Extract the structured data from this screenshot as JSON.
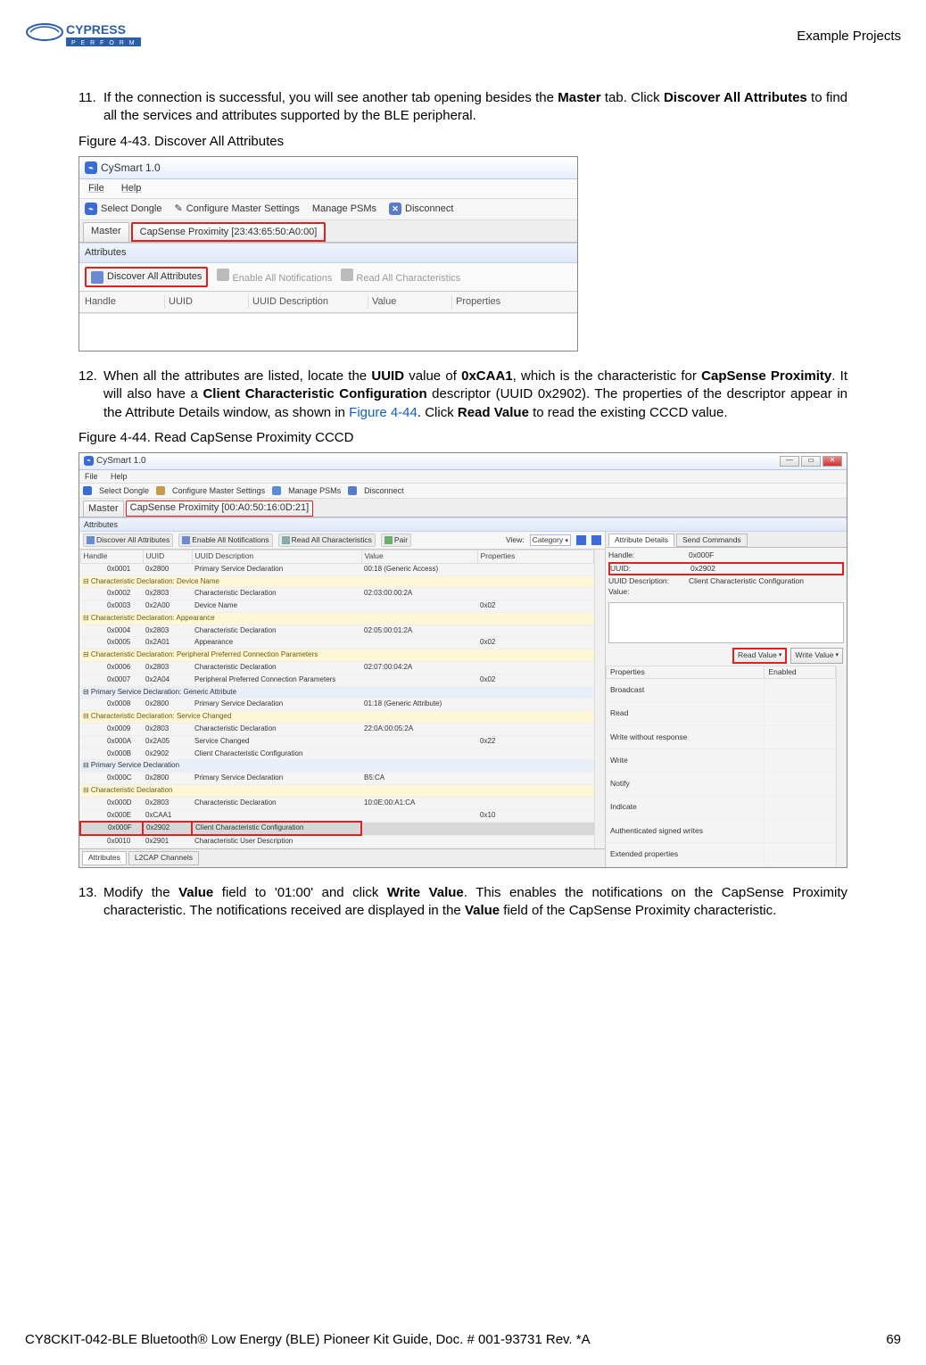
{
  "header": {
    "section": "Example Projects"
  },
  "logo": {
    "brand_top": "CYPRESS",
    "brand_sub": "P E R F O R M"
  },
  "step11": {
    "num": "11.",
    "text_a": "If the connection is successful, you will see another tab opening besides the ",
    "b1": "Master",
    "text_b": " tab. Click ",
    "b2": "Discover All Attributes",
    "text_c": " to find all the services and attributes supported by the BLE peripheral."
  },
  "fig43": {
    "caption": "Figure 4-43.  Discover All Attributes",
    "title": "CySmart 1.0",
    "menu_file": "File",
    "menu_help": "Help",
    "tb_select": "Select Dongle",
    "tb_conf": "Configure Master Settings",
    "tb_psm": "Manage PSMs",
    "tb_disc": "Disconnect",
    "tab_master": "Master",
    "tab_device": "CapSense Proximity [23:43:65:50:A0:00]",
    "attr_label": "Attributes",
    "btn_discover": "Discover All Attributes",
    "btn_enable": "Enable All Notifications",
    "btn_readall": "Read All Characteristics",
    "col_handle": "Handle",
    "col_uuid": "UUID",
    "col_uuiddesc": "UUID Description",
    "col_value": "Value",
    "col_props": "Properties"
  },
  "step12": {
    "num": "12.",
    "text_a": "When all the attributes are listed, locate the ",
    "b1": "UUID",
    "text_b": " value of ",
    "b2": "0xCAA1",
    "text_c": ", which is the characteristic for ",
    "b3": "CapSense Proximity",
    "text_d": ". It will also have a ",
    "b4": "Client Characteristic Configuration",
    "text_e": " descriptor (UUID 0x2902). The properties of the descriptor appear in the Attribute Details window, as shown in ",
    "link": "Figure 4-44",
    "text_f": ". Click ",
    "b5": "Read Value",
    "text_g": " to read the existing CCCD value."
  },
  "fig44": {
    "caption": "Figure 4-44.  Read CapSense Proximity CCCD",
    "title": "CySmart 1.0",
    "menu_file": "File",
    "menu_help": "Help",
    "tb_select": "Select Dongle",
    "tb_conf": "Configure Master Settings",
    "tb_psm": "Manage PSMs",
    "tb_disc": "Disconnect",
    "tab_master": "Master",
    "tab_device": "CapSense Proximity [00:A0:50:16:0D:21]",
    "attr_label": "Attributes",
    "btn_discover": "Discover All Attributes",
    "btn_enable": "Enable All Notifications",
    "btn_readall": "Read All Characteristics",
    "btn_pair": "Pair",
    "view": "View:",
    "view_val": "Category",
    "col_handle": "Handle",
    "col_uuid": "UUID",
    "col_uuiddesc": "UUID Description",
    "col_value": "Value",
    "col_props": "Properties",
    "rows": [
      {
        "t": "n",
        "h": "0x0001",
        "u": "0x2800",
        "d": "Primary Service Declaration",
        "v": "00:18 (Generic Access)",
        "p": ""
      },
      {
        "t": "g",
        "label": "Characteristic Declaration: Device Name"
      },
      {
        "t": "n",
        "h": "0x0002",
        "u": "0x2803",
        "d": "Characteristic Declaration",
        "v": "02:03:00:00:2A",
        "p": ""
      },
      {
        "t": "n",
        "h": "0x0003",
        "u": "0x2A00",
        "d": "Device Name",
        "v": "",
        "p": "0x02"
      },
      {
        "t": "g",
        "label": "Characteristic Declaration: Appearance"
      },
      {
        "t": "n",
        "h": "0x0004",
        "u": "0x2803",
        "d": "Characteristic Declaration",
        "v": "02:05:00:01:2A",
        "p": ""
      },
      {
        "t": "n",
        "h": "0x0005",
        "u": "0x2A01",
        "d": "Appearance",
        "v": "",
        "p": "0x02"
      },
      {
        "t": "g",
        "label": "Characteristic Declaration: Peripheral Preferred Connection Parameters"
      },
      {
        "t": "n",
        "h": "0x0006",
        "u": "0x2803",
        "d": "Characteristic Declaration",
        "v": "02:07:00:04:2A",
        "p": ""
      },
      {
        "t": "n",
        "h": "0x0007",
        "u": "0x2A04",
        "d": "Peripheral Preferred Connection Parameters",
        "v": "",
        "p": "0x02"
      },
      {
        "t": "b",
        "label": "Primary Service Declaration: Generic Attribute"
      },
      {
        "t": "n",
        "h": "0x0008",
        "u": "0x2800",
        "d": "Primary Service Declaration",
        "v": "01:18 (Generic Attribute)",
        "p": ""
      },
      {
        "t": "g",
        "label": "Characteristic Declaration: Service Changed"
      },
      {
        "t": "n",
        "h": "0x0009",
        "u": "0x2803",
        "d": "Characteristic Declaration",
        "v": "22:0A:00:05:2A",
        "p": ""
      },
      {
        "t": "n",
        "h": "0x000A",
        "u": "0x2A05",
        "d": "Service Changed",
        "v": "",
        "p": "0x22"
      },
      {
        "t": "n",
        "h": "0x000B",
        "u": "0x2902",
        "d": "Client Characteristic Configuration",
        "v": "",
        "p": ""
      },
      {
        "t": "b",
        "label": "Primary Service Declaration"
      },
      {
        "t": "n",
        "h": "0x000C",
        "u": "0x2800",
        "d": "Primary Service Declaration",
        "v": "B5:CA",
        "p": ""
      },
      {
        "t": "g",
        "label": "Characteristic Declaration"
      },
      {
        "t": "n",
        "h": "0x000D",
        "u": "0x2803",
        "d": "Characteristic Declaration",
        "v": "10:0E:00:A1:CA",
        "p": ""
      },
      {
        "t": "n",
        "h": "0x000E",
        "u": "0xCAA1",
        "d": "",
        "v": "",
        "p": "0x10"
      },
      {
        "t": "hl",
        "h": "0x000F",
        "u": "0x2902",
        "d": "Client Characteristic Configuration",
        "v": "",
        "p": "",
        "red": true
      },
      {
        "t": "n",
        "h": "0x0010",
        "u": "0x2901",
        "d": "Characteristic User Description",
        "v": "",
        "p": ""
      }
    ],
    "bottom_tab1": "Attributes",
    "bottom_tab2": "L2CAP Channels",
    "right_tab1": "Attribute Details",
    "right_tab2": "Send Commands",
    "det_handle_k": "Handle:",
    "det_handle_v": "0x000F",
    "det_uuid_k": "UUID:",
    "det_uuid_v": "0x2902",
    "det_desc_k": "UUID Description:",
    "det_desc_v": "Client Characteristic Configuration",
    "det_value_k": "Value:",
    "btn_read": "Read Value",
    "btn_write": "Write Value",
    "prop_h1": "Properties",
    "prop_h2": "Enabled",
    "props": [
      "Broadcast",
      "Read",
      "Write without response",
      "Write",
      "Notify",
      "Indicate",
      "Authenticated signed writes",
      "Extended properties"
    ]
  },
  "step13": {
    "num": "13.",
    "text_a": "Modify the ",
    "b1": "Value",
    "text_b": " field to '01:00' and click ",
    "b2": "Write Value",
    "text_c": ". This enables the notifications on the CapSense Proximity characteristic. The notifications received are displayed in the ",
    "b3": "Value",
    "text_d": " field of the CapSense Proximity characteristic."
  },
  "footer": {
    "left": "CY8CKIT-042-BLE Bluetooth® Low Energy (BLE) Pioneer Kit Guide, Doc. # 001-93731 Rev. *A",
    "right": "69"
  }
}
